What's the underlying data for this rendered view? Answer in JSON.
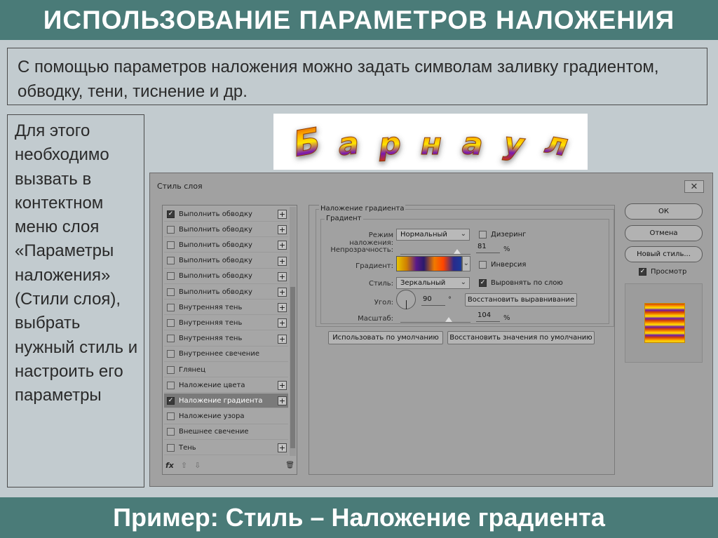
{
  "header": {
    "title": "ИСПОЛЬЗОВАНИЕ ПАРАМЕТРОВ НАЛОЖЕНИЯ"
  },
  "intro": {
    "text": "С помощью параметров наложения можно задать символам заливку градиентом, обводку, тени, тиснение и др."
  },
  "sidebar": {
    "text": "Для этого необходимо вызвать в контектном меню слоя «Параметры наложения» (Стили слоя), выбрать нужный стиль и настроить его параметры"
  },
  "logo": {
    "letters": [
      "Б",
      "а",
      "р",
      "н",
      "а",
      "у",
      "л"
    ]
  },
  "dialog": {
    "title": "Стиль слоя",
    "close_glyph": "✕",
    "styles": [
      {
        "label": "Выполнить обводку",
        "checked": true,
        "plus": true
      },
      {
        "label": "Выполнить обводку",
        "checked": false,
        "plus": true
      },
      {
        "label": "Выполнить обводку",
        "checked": false,
        "plus": true
      },
      {
        "label": "Выполнить обводку",
        "checked": false,
        "plus": true
      },
      {
        "label": "Выполнить обводку",
        "checked": false,
        "plus": true
      },
      {
        "label": "Выполнить обводку",
        "checked": false,
        "plus": true
      },
      {
        "label": "Внутренняя тень",
        "checked": false,
        "plus": true
      },
      {
        "label": "Внутренняя тень",
        "checked": false,
        "plus": true
      },
      {
        "label": "Внутренняя тень",
        "checked": false,
        "plus": true
      },
      {
        "label": "Внутреннее свечение",
        "checked": false,
        "plus": false
      },
      {
        "label": "Глянец",
        "checked": false,
        "plus": false
      },
      {
        "label": "Наложение цвета",
        "checked": false,
        "plus": true
      },
      {
        "label": "Наложение градиента",
        "checked": true,
        "plus": true,
        "selected": true
      },
      {
        "label": "Наложение узора",
        "checked": false,
        "plus": false
      },
      {
        "label": "Внешнее свечение",
        "checked": false,
        "plus": false
      },
      {
        "label": "Тень",
        "checked": false,
        "plus": true
      }
    ],
    "list_footer": {
      "fx": "fx",
      "up": "⇧",
      "down": "⇩",
      "trash": "🗑"
    },
    "gradient_overlay": {
      "group_title": "Наложение градиента",
      "sub_title": "Градиент",
      "blend_mode_label": "Режим наложения:",
      "blend_mode_value": "Нормальный",
      "dither_label": "Дизеринг",
      "dither_checked": false,
      "opacity_label": "Непрозрачность:",
      "opacity_value": "81",
      "opacity_unit": "%",
      "opacity_fraction": 0.81,
      "gradient_label": "Градиент:",
      "reverse_label": "Инверсия",
      "reverse_checked": false,
      "style_label": "Стиль:",
      "style_value": "Зеркальный",
      "align_label": "Выровнять по слою",
      "align_checked": true,
      "angle_label": "Угол:",
      "angle_value": "90",
      "angle_unit": "°",
      "reset_align_button": "Восстановить выравнивание",
      "scale_label": "Масштаб:",
      "scale_value": "104",
      "scale_unit": "%",
      "scale_fraction": 0.69
    },
    "default_button": "Использовать по умолчанию",
    "reset_default_button": "Восстановить значения по умолчанию",
    "ok_button": "ОК",
    "cancel_button": "Отмена",
    "new_style_button": "Новый стиль...",
    "preview_label": "Просмотр",
    "preview_checked": true
  },
  "footer": {
    "title": "Пример: Стиль – Наложение градиента"
  },
  "colors": {
    "banner": "#4a7b78",
    "background": "#c2cbcf",
    "dialog": "#a1a1a1"
  }
}
